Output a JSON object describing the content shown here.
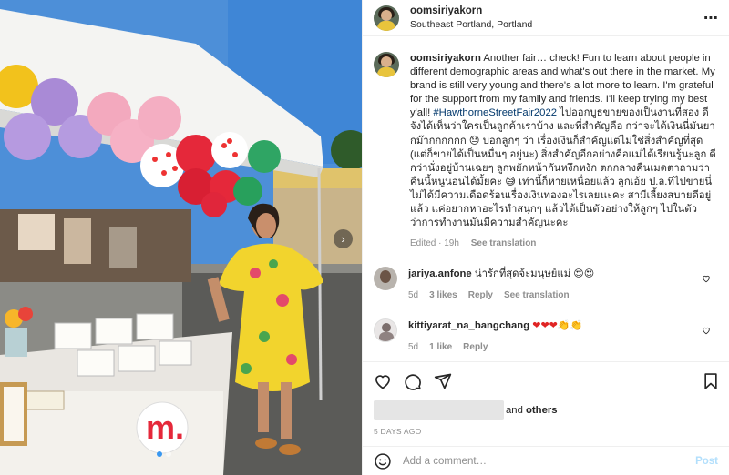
{
  "post": {
    "username": "oomsiriyakorn",
    "location": "Southeast Portland, Portland",
    "more_icon": "⋯"
  },
  "caption": {
    "username": "oomsiriyakorn",
    "text_before": "Another fair… check! Fun to learn about people in different demographic areas and what's out there in the market. My brand is still very young and there's a lot more to learn. I'm grateful for the support from my family and friends. I'll keep trying my best y'all! ",
    "hashtag": "#HawthorneStreetFair2022",
    "text_after": " ไปออกบูธขายของเป็นงานที่สอง ดีจังได้เห็นว่าใครเป็นลูกค้าเราบ้าง และที่สำคัญคือ กว่าจะได้เงินนี่มันยากม๊ากกกกกก 😓 บอกลูกๆ ว่า เรื่องเงินก็สำคัญแต่ไม่ใช่สิ่งสำคัญที่สุด (แต่ก็ขายได้เป็นหมื่นๆ อยู่นะ) สิ่งสำคัญอีกอย่างคือแม่ได้เรียนรู้นะลูก ดีกว่านั่งอยู่บ้านเฉยๆ ลูกพยักหน้ากันหงึกหงัก ตกกลางคืนเมดตาถามว่า คืนนี้หนูนอนได้มั้ยคะ 😅 เท่านี้ก็หายเหนื่อยแล้ว ลูกเอ้ย ป.ล.ที่ไปขายนี่ไม่ได้มีความเดือดร้อนเรื่องเงินทองอะไรเลยนะคะ สามีเลี้ยงสบายดีอยู่แล้ว แค่อยากหาอะไรทำสนุกๆ แล้วได้เป็นตัวอย่างให้ลูกๆ ไปในตัวว่าการทำงานมันมีความสำคัญนะคะ",
    "edited": "Edited · 19h",
    "see_translation": "See translation"
  },
  "comments": [
    {
      "username": "jariya.anfone",
      "text": "น่ารักที่สุดจ้ะมนุษย์แม่",
      "emoji": "😍😍",
      "age": "5d",
      "likes": "3 likes",
      "reply": "Reply",
      "see_translation": "See translation"
    },
    {
      "username": "kittiyarat_na_bangchang",
      "hearts": "❤❤❤",
      "claps": "👏👏",
      "age": "5d",
      "likes": "1 like",
      "reply": "Reply"
    }
  ],
  "likes_line": {
    "connector": "and",
    "others": "others"
  },
  "date": "5 DAYS AGO",
  "add_comment": {
    "placeholder": "Add a comment…",
    "post_label": "Post"
  },
  "colors": {
    "link_blue": "#00376b",
    "post_disabled": "#b2dffc",
    "meta_gray": "#8e8e8e",
    "carousel_dot": "#3897f0"
  }
}
